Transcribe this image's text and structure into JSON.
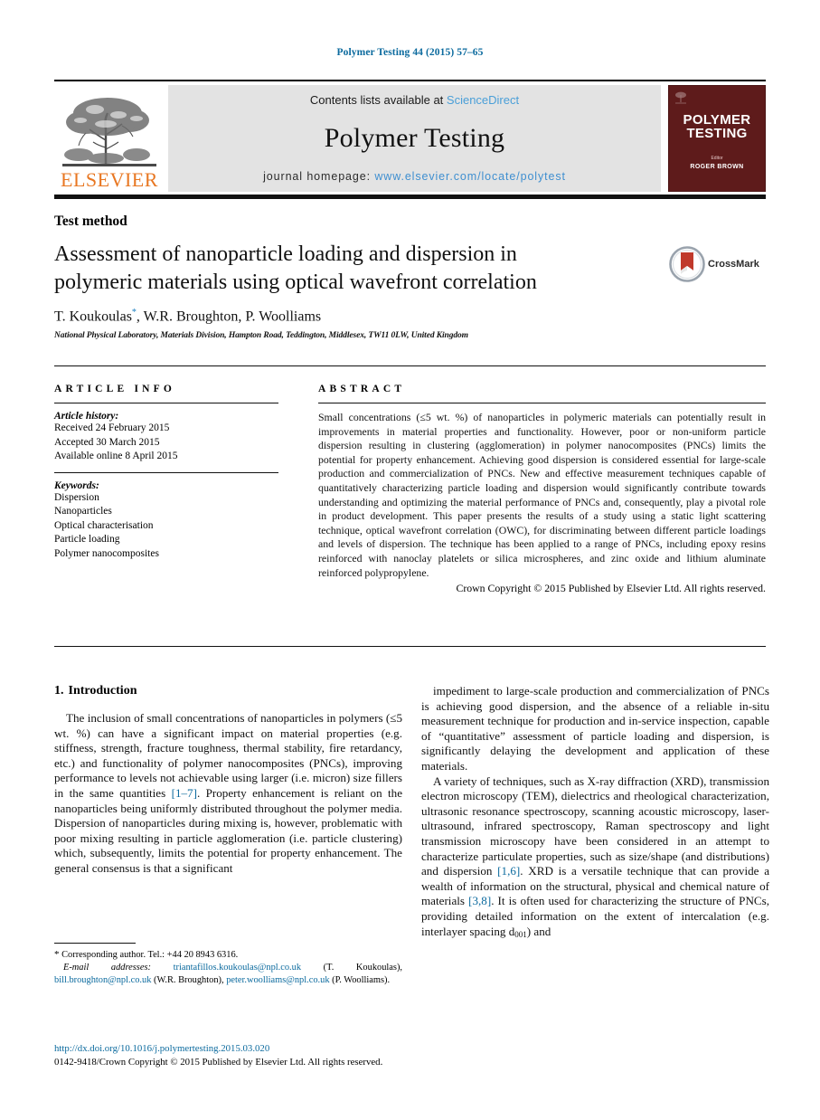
{
  "running_head": "Polymer Testing 44 (2015) 57–65",
  "masthead": {
    "contents_prefix": "Contents lists available at ",
    "sciencedirect": "ScienceDirect",
    "journal_title": "Polymer Testing",
    "homepage_prefix": "journal homepage: ",
    "homepage_url": "www.elsevier.com/locate/polytest",
    "publisher_name": "ELSEVIER",
    "cover": {
      "title_line1": "POLYMER",
      "title_line2": "TESTING",
      "editor_label": "Editor",
      "editor_name": "ROGER BROWN"
    },
    "colors": {
      "link": "#4a9fd8",
      "elsevier_orange": "#e87722",
      "cover_maroon": "#5e1b1b",
      "band_gray": "#e3e3e3"
    }
  },
  "article": {
    "section_type": "Test method",
    "title": "Assessment of nanoparticle loading and dispersion in polymeric materials using optical wavefront correlation",
    "crossmark_label": "CrossMark",
    "authors": "T. Koukoulas",
    "authors_rest": ", W.R. Broughton, P. Woolliams",
    "corresponding_marker": "*",
    "affiliation": "National Physical Laboratory, Materials Division, Hampton Road, Teddington, Middlesex, TW11 0LW, United Kingdom"
  },
  "article_info": {
    "heading": "ARTICLE INFO",
    "history_label": "Article history:",
    "history": [
      "Received 24 February 2015",
      "Accepted 30 March 2015",
      "Available online 8 April 2015"
    ],
    "keywords_label": "Keywords:",
    "keywords": [
      "Dispersion",
      "Nanoparticles",
      "Optical characterisation",
      "Particle loading",
      "Polymer nanocomposites"
    ]
  },
  "abstract": {
    "heading": "ABSTRACT",
    "body": "Small concentrations (≤5 wt. %) of nanoparticles in polymeric materials can potentially result in improvements in material properties and functionality. However, poor or non-uniform particle dispersion resulting in clustering (agglomeration) in polymer nanocomposites (PNCs) limits the potential for property enhancement. Achieving good dispersion is considered essential for large-scale production and commercialization of PNCs. New and effective measurement techniques capable of quantitatively characterizing particle loading and dispersion would significantly contribute towards understanding and optimizing the material performance of PNCs and, consequently, play a pivotal role in product development. This paper presents the results of a study using a static light scattering technique, optical wavefront correlation (OWC), for discriminating between different particle loadings and levels of dispersion. The technique has been applied to a range of PNCs, including epoxy resins reinforced with nanoclay platelets or silica microspheres, and zinc oxide and lithium aluminate reinforced polypropylene.",
    "copyright": "Crown Copyright © 2015 Published by Elsevier Ltd. All rights reserved."
  },
  "body": {
    "section_number": "1.",
    "section_title": "Introduction",
    "left_paragraph_1_a": "The inclusion of small concentrations of nanoparticles in polymers (≤5 wt. %) can have a significant impact on material properties (e.g. stiffness, strength, fracture toughness, thermal stability, fire retardancy, etc.) and functionality of polymer nanocomposites (PNCs), improving performance to levels not achievable using larger (i.e. micron) size fillers in the same quantities ",
    "left_ref_1": "[1–7]",
    "left_paragraph_1_b": ". Property enhancement is reliant on the nanoparticles being uniformly distributed throughout the polymer media. Dispersion of nanoparticles during mixing is, however, problematic with poor mixing resulting in particle agglomeration (i.e. particle clustering) which, subsequently, limits the potential for property enhancement. The general consensus is that a significant",
    "right_paragraph_1": "impediment to large-scale production and commercialization of PNCs is achieving good dispersion, and the absence of a reliable in-situ measurement technique for production and in-service inspection, capable of “quantitative” assessment of particle loading and dispersion, is significantly delaying the development and application of these materials.",
    "right_paragraph_2_a": "A variety of techniques, such as X-ray diffraction (XRD), transmission electron microscopy (TEM), dielectrics and rheological characterization, ultrasonic resonance spectroscopy, scanning acoustic microscopy, laser-ultrasound, infrared spectroscopy, Raman spectroscopy and light transmission microscopy have been considered in an attempt to characterize particulate properties, such as size/shape (and distributions) and dispersion ",
    "right_ref_1": "[1,6]",
    "right_paragraph_2_b": ". XRD is a versatile technique that can provide a wealth of information on the structural, physical and chemical nature of materials ",
    "right_ref_2": "[3,8]",
    "right_paragraph_2_c": ". It is often used for characterizing the structure of PNCs, providing detailed information on the extent of intercalation (e.g. interlayer spacing d",
    "right_subscript": "001",
    "right_paragraph_2_d": ") and"
  },
  "footnotes": {
    "corresponding": "Corresponding author. Tel.: +44 20 8943 6316.",
    "email_label": "E-mail addresses:",
    "emails": [
      {
        "address": "triantafillos.koukoulas@npl.co.uk",
        "name": "(T. Koukoulas),"
      },
      {
        "address": "bill.broughton@npl.co.uk",
        "name": "(W.R. Broughton),"
      },
      {
        "address": "peter.woolliams@npl.co.uk",
        "name": "(P. Woolliams)."
      }
    ]
  },
  "footer": {
    "doi": "http://dx.doi.org/10.1016/j.polymertesting.2015.03.020",
    "issn_line": "0142-9418/Crown Copyright © 2015 Published by Elsevier Ltd. All rights reserved."
  }
}
